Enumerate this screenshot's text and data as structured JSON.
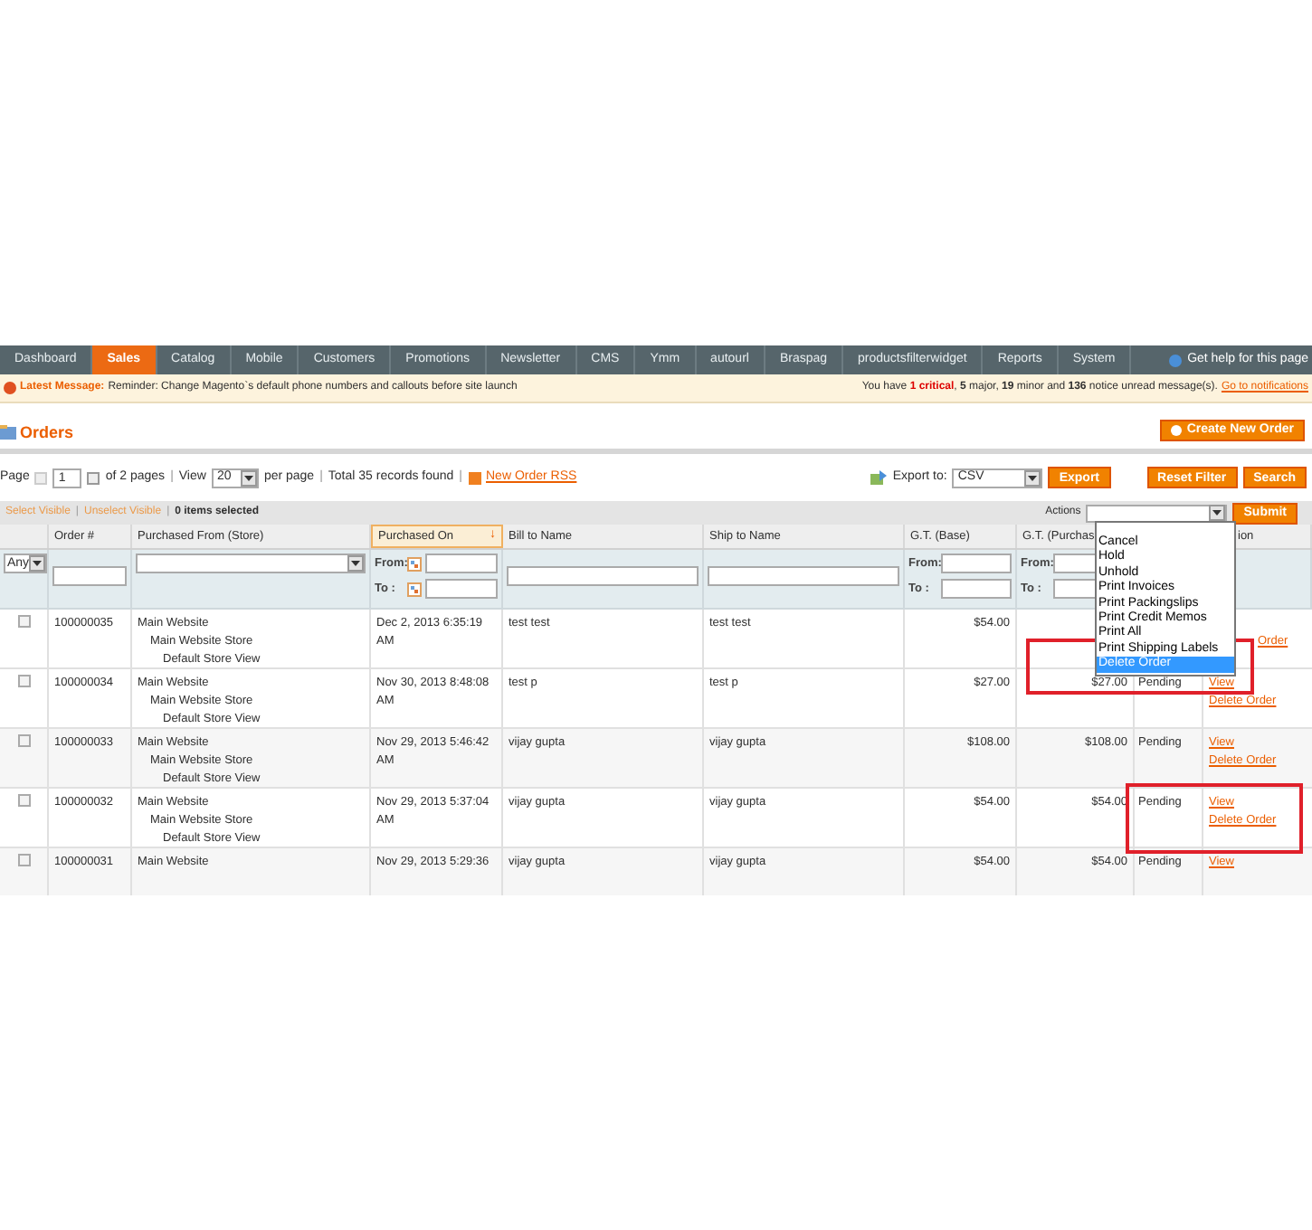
{
  "nav": {
    "items": [
      {
        "label": "Dashboard",
        "selected": false
      },
      {
        "label": "Sales",
        "selected": true
      },
      {
        "label": "Catalog",
        "selected": false
      },
      {
        "label": "Mobile",
        "selected": false
      },
      {
        "label": "Customers",
        "selected": false
      },
      {
        "label": "Promotions",
        "selected": false
      },
      {
        "label": "Newsletter",
        "selected": false
      },
      {
        "label": "CMS",
        "selected": false
      },
      {
        "label": "Ymm",
        "selected": false
      },
      {
        "label": "autourl",
        "selected": false
      },
      {
        "label": "Braspag",
        "selected": false
      },
      {
        "label": "productsfilterwidget",
        "selected": false
      },
      {
        "label": "Reports",
        "selected": false
      },
      {
        "label": "System",
        "selected": false
      }
    ],
    "help": "Get help for this page"
  },
  "message": {
    "label": "Latest Message:",
    "text": "Reminder: Change Magento`s default phone numbers and callouts before site launch",
    "summary": [
      {
        "text": "You have ",
        "kind": "plain"
      },
      {
        "text": "1 critical",
        "kind": "critical"
      },
      {
        "text": ", ",
        "kind": "plain"
      },
      {
        "text": "5",
        "kind": "count"
      },
      {
        "text": " major, ",
        "kind": "plain"
      },
      {
        "text": "19",
        "kind": "count"
      },
      {
        "text": " minor and ",
        "kind": "plain"
      },
      {
        "text": "136",
        "kind": "count"
      },
      {
        "text": " notice unread message(s).",
        "kind": "plain"
      }
    ],
    "link": "Go to notifications"
  },
  "title": "Orders",
  "create_button": "Create New Order",
  "pager": {
    "page_label": "Page",
    "page": "1",
    "of_pages": "of 2 pages",
    "separators": [
      "|",
      "|",
      "|"
    ],
    "view_label": "View",
    "view": "20",
    "per_page": "per page",
    "total": "Total 35 records found",
    "rss": "New Order RSS",
    "export_label": "Export to:",
    "export_format": "CSV",
    "export_button": "Export",
    "reset_button": "Reset Filter",
    "search_button": "Search"
  },
  "massaction": {
    "select_visible": "Select Visible",
    "unselect_visible": "Unselect Visible",
    "separators": [
      "|",
      "|"
    ],
    "count": "0 items selected",
    "actions_label": "Actions",
    "submit": "Submit",
    "options": [
      {
        "label": "Cancel",
        "selected": false
      },
      {
        "label": "Hold",
        "selected": false
      },
      {
        "label": "Unhold",
        "selected": false
      },
      {
        "label": "Print Invoices",
        "selected": false
      },
      {
        "label": "Print Packingslips",
        "selected": false
      },
      {
        "label": "Print Credit Memos",
        "selected": false
      },
      {
        "label": "Print All",
        "selected": false
      },
      {
        "label": "Print Shipping Labels",
        "selected": false
      },
      {
        "label": "Delete Order",
        "selected": true
      }
    ]
  },
  "columns": [
    {
      "kind": "check",
      "filter_value": "Any"
    },
    {
      "label": "Order #",
      "kind": "text"
    },
    {
      "label": "Purchased From (Store)",
      "kind": "select"
    },
    {
      "label": "Purchased On",
      "kind": "date",
      "sorted": true,
      "sort_icon": "↓",
      "filter_from": "From:",
      "filter_to": "To :"
    },
    {
      "label": "Bill to Name",
      "kind": "text"
    },
    {
      "label": "Ship to Name",
      "kind": "text"
    },
    {
      "label": "G.T. (Base)",
      "kind": "range",
      "filter_from": "From:",
      "filter_to": "To :"
    },
    {
      "label": "G.T. (Purchas",
      "kind": "range",
      "filter_from": "From:",
      "filter_to": "To :"
    },
    {
      "kind": "none"
    },
    {
      "label": "ion",
      "kind": "none"
    }
  ],
  "rows": [
    {
      "selected": false,
      "order": "100000035",
      "store": [
        "Main Website",
        "Main Website Store",
        "Default Store View"
      ],
      "date": [
        "Dec 2, 2013 6:35:19",
        "AM"
      ],
      "bill": "test test",
      "ship": "test test",
      "gt_base": "$54.00",
      "actions": [
        {
          "text": "Order",
          "kind": "tail"
        }
      ]
    },
    {
      "selected": false,
      "order": "100000034",
      "store": [
        "Main Website",
        "Main Website Store",
        "Default Store View"
      ],
      "date": [
        "Nov 30, 2013 8:48:08",
        "AM"
      ],
      "bill": "test p",
      "ship": "test p",
      "gt_base": "$27.00",
      "gt_purchased": "$27.00",
      "status": "Pending",
      "actions": [
        {
          "text": "View",
          "kind": "link"
        },
        {
          "text": "Delete Order",
          "kind": "link"
        }
      ]
    },
    {
      "selected": false,
      "order": "100000033",
      "store": [
        "Main Website",
        "Main Website Store",
        "Default Store View"
      ],
      "date": [
        "Nov 29, 2013 5:46:42",
        "AM"
      ],
      "bill": "vijay gupta",
      "ship": "vijay gupta",
      "gt_base": "$108.00",
      "gt_purchased": "$108.00",
      "status": "Pending",
      "actions": [
        {
          "text": "View",
          "kind": "link"
        },
        {
          "text": "Delete Order",
          "kind": "link"
        }
      ]
    },
    {
      "selected": false,
      "order": "100000032",
      "store": [
        "Main Website",
        "Main Website Store",
        "Default Store View"
      ],
      "date": [
        "Nov 29, 2013 5:37:04",
        "AM"
      ],
      "bill": "vijay gupta",
      "ship": "vijay gupta",
      "gt_base": "$54.00",
      "gt_purchased": "$54.00",
      "status": "Pending",
      "actions": [
        {
          "text": "View",
          "kind": "link"
        },
        {
          "text": "Delete Order",
          "kind": "link"
        }
      ]
    },
    {
      "selected": false,
      "order": "100000031",
      "store": [
        "Main Website"
      ],
      "date": [
        "Nov 29, 2013 5:29:36"
      ],
      "bill": "vijay gupta",
      "ship": "vijay gupta",
      "gt_base": "$54.00",
      "gt_purchased": "$54.00",
      "status": "Pending",
      "actions": [
        {
          "text": "View",
          "kind": "link"
        }
      ]
    }
  ]
}
